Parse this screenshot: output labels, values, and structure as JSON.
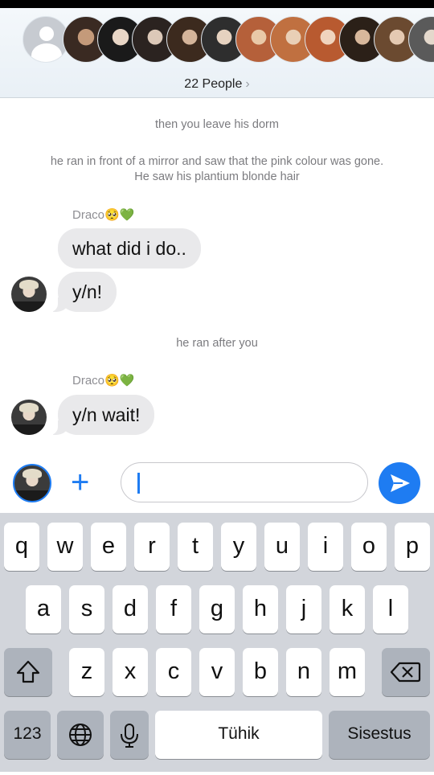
{
  "header": {
    "people_label": "22 People",
    "chevron": "›"
  },
  "messages": {
    "sys1": "then you leave his dorm",
    "sys2_line1": "he ran in front of a mirror and saw that the pink colour was gone.",
    "sys2_line2": "He saw his plantium blonde hair",
    "sender1": "Draco🥺💚",
    "msg1": "what did i do..",
    "msg2": "y/n!",
    "sys3": "he ran after you",
    "sender2": "Draco🥺💚",
    "msg3": "y/n wait!"
  },
  "input": {
    "plus": "+"
  },
  "keyboard": {
    "row1": [
      "q",
      "w",
      "e",
      "r",
      "t",
      "y",
      "u",
      "i",
      "o",
      "p"
    ],
    "row2": [
      "a",
      "s",
      "d",
      "f",
      "g",
      "h",
      "j",
      "k",
      "l"
    ],
    "row3": [
      "z",
      "x",
      "c",
      "v",
      "b",
      "n",
      "m"
    ],
    "numbers": "123",
    "space": "Tühik",
    "return": "Sisestus"
  },
  "colors": {
    "accent": "#1e7cf2",
    "bubble": "#e9e9eb",
    "keyboard_bg": "#d2d5db"
  }
}
